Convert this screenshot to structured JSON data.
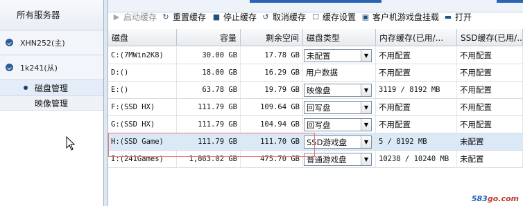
{
  "left": {
    "title": "所有服务器",
    "servers": [
      {
        "label": "XHN252(主)"
      },
      {
        "label": "1k241(从)"
      }
    ],
    "subitems": [
      {
        "label": "磁盘管理",
        "active": true
      },
      {
        "label": "映像管理",
        "active": false
      }
    ]
  },
  "toolbar": {
    "items": [
      {
        "label": "启动缓存",
        "icon": "play-icon",
        "disabled": true
      },
      {
        "label": "重置缓存",
        "icon": "reset-icon",
        "disabled": false
      },
      {
        "label": "停止缓存",
        "icon": "stop-icon",
        "disabled": false
      },
      {
        "label": "取消缓存",
        "icon": "cancel-icon",
        "disabled": false
      },
      {
        "label": "缓存设置",
        "icon": "checkbox-icon",
        "disabled": false
      },
      {
        "label": "客户机游戏盘挂载",
        "icon": "mount-icon",
        "disabled": false
      },
      {
        "label": "打开",
        "icon": "folder-icon",
        "disabled": false
      }
    ]
  },
  "table": {
    "headers": [
      "磁盘",
      "容量",
      "剩余空间",
      "磁盘类型",
      "内存缓存(已用/...",
      "SSD缓存(已用/..."
    ],
    "rows": [
      {
        "disk": "C:(7MWin2K8)",
        "capacity": "30.00 GB",
        "free": "17.78 GB",
        "type": "未配置",
        "type_select": true,
        "mem": "不用配置",
        "ssd": "不用配置"
      },
      {
        "disk": "D:()",
        "capacity": "18.00 GB",
        "free": "16.29 GB",
        "type": "用户数据",
        "type_select": false,
        "mem": "不用配置",
        "ssd": "不用配置"
      },
      {
        "disk": "E:()",
        "capacity": "63.78 GB",
        "free": "19.79 GB",
        "type": "映像盘",
        "type_select": true,
        "mem": "3119 / 8192 MB",
        "ssd": "不用配置"
      },
      {
        "disk": "F:(SSD HX)",
        "capacity": "111.79 GB",
        "free": "109.64 GB",
        "type": "回写盘",
        "type_select": true,
        "mem": "不用配置",
        "ssd": "不用配置"
      },
      {
        "disk": "G:(SSD HX)",
        "capacity": "111.79 GB",
        "free": "104.94 GB",
        "type": "回写盘",
        "type_select": true,
        "mem": "不用配置",
        "ssd": "不用配置"
      },
      {
        "disk": "H:(SSD Game)",
        "capacity": "111.79 GB",
        "free": "111.70 GB",
        "type": "SSD游戏盘",
        "type_select": true,
        "mem": "5 / 8192 MB",
        "ssd": "未配置",
        "selected": true
      },
      {
        "disk": "I:(241Games)",
        "capacity": "1,863.02 GB",
        "free": "475.70 GB",
        "type": "普通游戏盘",
        "type_select": true,
        "mem": "10238 / 10240 MB",
        "ssd": "未配置"
      }
    ]
  },
  "watermark": {
    "num": "583",
    "rest": "go.com"
  },
  "colors": {
    "accent": "#2b63b5",
    "selected_row": "#dbe9f7",
    "highlight": "#e07a7a"
  }
}
